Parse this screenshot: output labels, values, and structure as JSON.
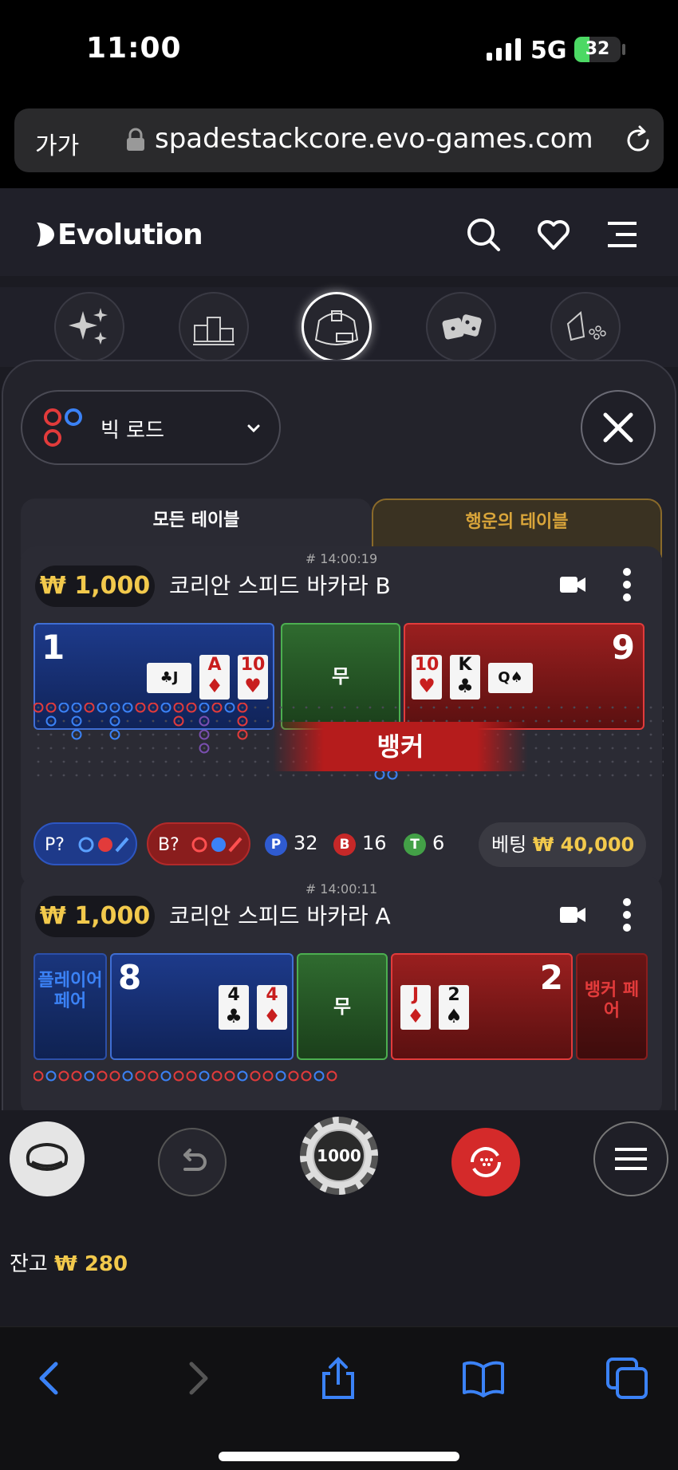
{
  "status_bar": {
    "time": "11:00",
    "network": "5G",
    "battery": "32",
    "battery_level": 0.32
  },
  "browser": {
    "text_size_label": "가가",
    "url": "spadestackcore.evo-games.com"
  },
  "app": {
    "brand": "Evolution",
    "categories": [
      "sparkles-icon",
      "podium-icon",
      "baccarat-icon",
      "dice-icon",
      "roulette-icon"
    ],
    "road_selector": {
      "label": "빅 로드"
    },
    "tabs": {
      "all_tables": "모든 테이블",
      "lucky_tables": "행운의 테이블"
    }
  },
  "tables": [
    {
      "round": "# 14:00:19",
      "limit": "₩ 1,000",
      "name": "코리안 스피드 바카라 B",
      "player_score": "1",
      "tie_label": "무",
      "banker_score": "9",
      "result": "뱅커",
      "player_predict": "P?",
      "banker_predict": "B?",
      "stats": {
        "p_label": "P",
        "p_count": "32",
        "b_label": "B",
        "b_count": "16",
        "t_label": "T",
        "t_count": "6"
      },
      "bet_label": "베팅",
      "bet_amount": "₩ 40,000"
    },
    {
      "round": "# 14:00:11",
      "limit": "₩ 1,000",
      "name": "코리안 스피드 바카라 A",
      "player_pair": "플레이어 페어",
      "player_score": "8",
      "tie_label": "무",
      "banker_score": "2",
      "banker_pair": "뱅커 페어"
    }
  ],
  "controls": {
    "chip_value": "1000",
    "balance_label": "잔고",
    "balance_amount": "₩ 280"
  },
  "colors": {
    "player": "#1d3a8a",
    "banker": "#b51c1c",
    "tie": "#2f6b2f",
    "gold": "#f2c94c"
  }
}
